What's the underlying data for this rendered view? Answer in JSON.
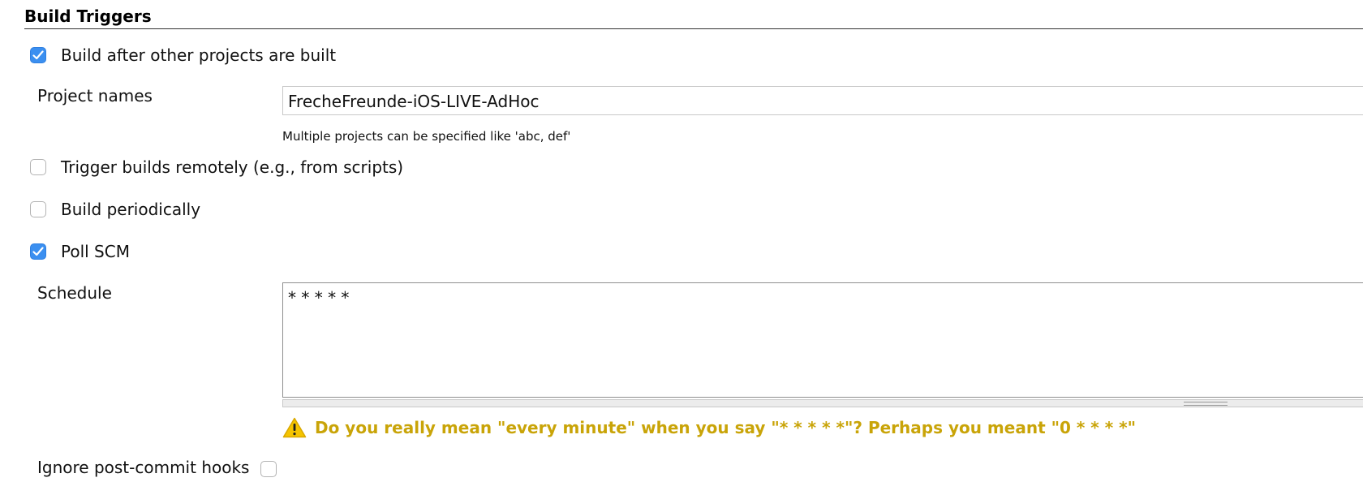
{
  "section": {
    "title": "Build Triggers"
  },
  "triggers": {
    "build_after": {
      "label": "Build after other projects are built",
      "checked": true
    },
    "project_names": {
      "label": "Project names",
      "value": "FrecheFreunde-iOS-LIVE-AdHoc",
      "help": "Multiple projects can be specified like 'abc, def'"
    },
    "trigger_remote": {
      "label": "Trigger builds remotely (e.g., from scripts)",
      "checked": false
    },
    "build_periodically": {
      "label": "Build periodically",
      "checked": false
    },
    "poll_scm": {
      "label": "Poll SCM",
      "checked": true
    },
    "schedule": {
      "label": "Schedule",
      "value": "* * * * *",
      "warning": "Do you really mean \"every minute\" when you say \"* * * * *\"? Perhaps you meant \"0 * * * *\""
    },
    "ignore_hooks": {
      "label": "Ignore post-commit hooks",
      "checked": false
    }
  },
  "colors": {
    "checkbox_checked": "#3b8ff0",
    "warning_text": "#c9a408",
    "warning_icon": "#f5c400"
  },
  "icons": {
    "check": "check-icon",
    "warning": "warning-icon"
  }
}
